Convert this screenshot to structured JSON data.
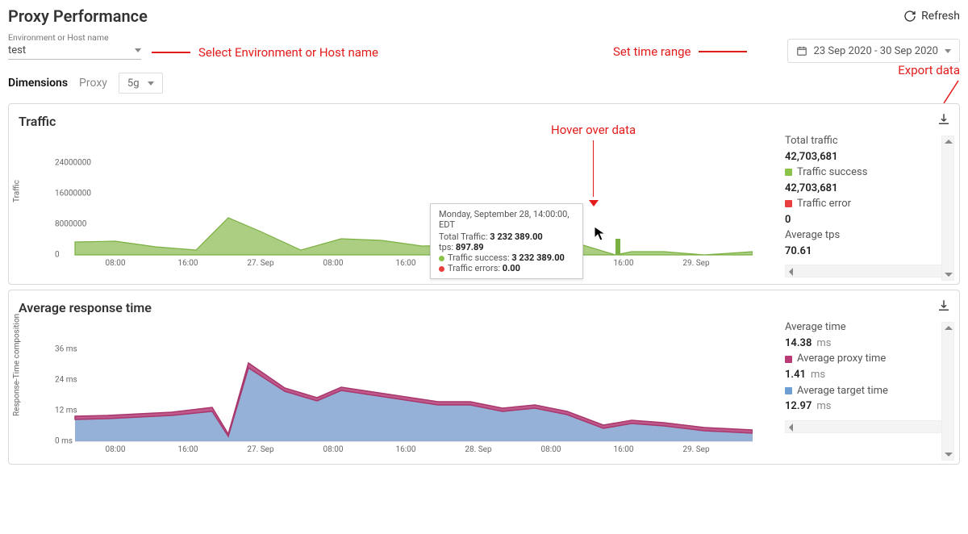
{
  "header": {
    "title": "Proxy Performance",
    "refresh": "Refresh"
  },
  "env": {
    "label": "Environment or Host name",
    "value": "test"
  },
  "date_range": "23 Sep 2020 - 30 Sep 2020",
  "dimensions": {
    "label": "Dimensions",
    "proxy_label": "Proxy",
    "proxy_value": "5g"
  },
  "annotations": {
    "env": "Select Environment or Host name",
    "time": "Set time range",
    "hover": "Hover over data",
    "export": "Export data"
  },
  "traffic_panel": {
    "title": "Traffic",
    "ylabel": "Traffic",
    "legend": {
      "total_label": "Total traffic",
      "total_value": "42,703,681",
      "success_label": "Traffic success",
      "success_value": "42,703,681",
      "error_label": "Traffic error",
      "error_value": "0",
      "avg_tps_label": "Average tps",
      "avg_tps_value": "70.61"
    },
    "tooltip": {
      "header": "Monday, September 28, 14:00:00, EDT",
      "total_label": "Total Traffic:",
      "total_value": "3 232 389.00",
      "tps_label": "tps:",
      "tps_value": "897.89",
      "success_label": "Traffic success:",
      "success_value": "3 232 389.00",
      "errors_label": "Traffic errors:",
      "errors_value": "0.00"
    }
  },
  "rt_panel": {
    "title": "Average response time",
    "ylabel": "Response-Time composition",
    "legend": {
      "avg_label": "Average time",
      "avg_value": "14.38",
      "proxy_label": "Average proxy time",
      "proxy_value": "1.41",
      "target_label": "Average target time",
      "target_value": "12.97",
      "unit": "ms"
    }
  },
  "x_ticks": [
    "08:00",
    "16:00",
    "27. Sep",
    "08:00",
    "16:00",
    "28. Sep",
    "08:00",
    "16:00",
    "29. Sep"
  ],
  "traffic_yticks": [
    "0",
    "8000000",
    "16000000",
    "24000000"
  ],
  "rt_yticks": [
    "0 ms",
    "12 ms",
    "24 ms",
    "36 ms"
  ],
  "chart_data": [
    {
      "type": "area",
      "title": "Traffic",
      "ylabel": "Traffic",
      "ylim": [
        0,
        24000000
      ],
      "x_categories": [
        "08:00",
        "16:00",
        "27. Sep",
        "08:00",
        "16:00",
        "28. Sep",
        "08:00",
        "16:00",
        "29. Sep"
      ],
      "series": [
        {
          "name": "Traffic success",
          "color": "#8BC34A",
          "values": [
            3300000,
            3500000,
            2100000,
            1300000,
            9700000,
            6100000,
            1300000,
            4200000,
            3900000,
            2400000,
            2500000,
            2100000,
            3232389,
            2200000,
            900000,
            800000,
            900000
          ]
        },
        {
          "name": "Traffic error",
          "color": "#e83e3e",
          "values": [
            0,
            0,
            0,
            0,
            0,
            0,
            0,
            0,
            0,
            0,
            0,
            0,
            0,
            0,
            0,
            0,
            0
          ]
        }
      ],
      "annotations": [
        {
          "x_label": "Monday, September 28, 14:00:00, EDT",
          "Total Traffic": 3232389.0,
          "tps": 897.89,
          "Traffic success": 3232389.0,
          "Traffic errors": 0.0
        }
      ]
    },
    {
      "type": "area",
      "title": "Average response time",
      "ylabel": "Response-Time composition",
      "ylim": [
        0,
        36
      ],
      "x_categories": [
        "08:00",
        "16:00",
        "27. Sep",
        "08:00",
        "16:00",
        "28. Sep",
        "08:00",
        "16:00",
        "29. Sep"
      ],
      "series": [
        {
          "name": "Average target time",
          "color": "#6e9fd4",
          "values": [
            8.5,
            8.8,
            9.6,
            10.2,
            11.8,
            2.0,
            28.5,
            19.6,
            16.0,
            20.0,
            18.0,
            16.2,
            14.2,
            14.0,
            11.8,
            13.0,
            10.4,
            5.2,
            7.0,
            6.1,
            4.0,
            3.3
          ]
        },
        {
          "name": "Average proxy time",
          "color": "#b93a75",
          "values": [
            1.2,
            1.2,
            1.2,
            1.3,
            1.4,
            0.5,
            2.0,
            1.6,
            1.4,
            1.6,
            1.5,
            1.4,
            1.3,
            1.3,
            1.2,
            1.3,
            1.2,
            0.9,
            1.0,
            0.9,
            0.7,
            0.6
          ]
        }
      ]
    }
  ]
}
